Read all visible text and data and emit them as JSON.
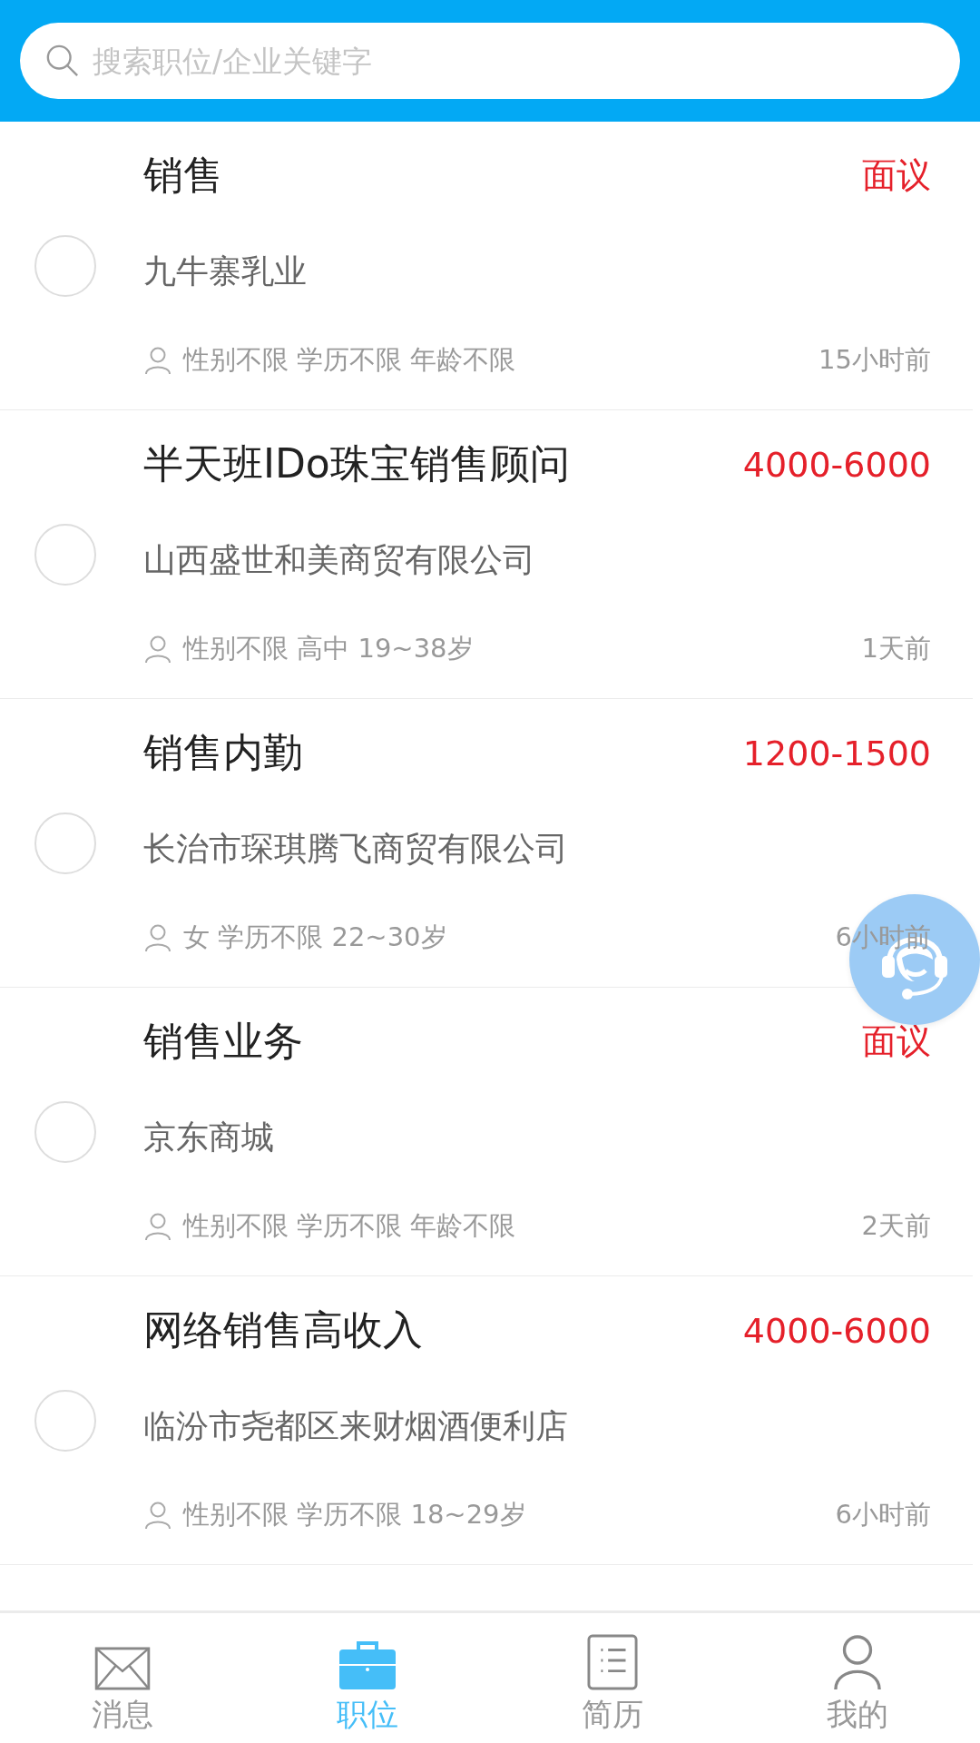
{
  "search": {
    "placeholder": "搜索职位/企业关键字"
  },
  "jobs": [
    {
      "title": "销售",
      "salary": "面议",
      "company": "九牛寨乳业",
      "requirements": "性别不限 学历不限 年龄不限",
      "posted": "15小时前",
      "selected": false
    },
    {
      "title": "半天班IDo珠宝销售顾问",
      "salary": "4000-6000",
      "company": "山西盛世和美商贸有限公司",
      "requirements": "性别不限 高中 19~38岁",
      "posted": "1天前",
      "selected": false
    },
    {
      "title": "销售内勤",
      "salary": "1200-1500",
      "company": "长治市琛琪腾飞商贸有限公司",
      "requirements": "女 学历不限 22~30岁",
      "posted": "6小时前",
      "selected": false
    },
    {
      "title": "销售业务",
      "salary": "面议",
      "company": "京东商城",
      "requirements": "性别不限 学历不限 年龄不限",
      "posted": "2天前",
      "selected": false
    },
    {
      "title": "网络销售高收入",
      "salary": "4000-6000",
      "company": "临汾市尧都区来财烟酒便利店",
      "requirements": "性别不限 学历不限 18~29岁",
      "posted": "6小时前",
      "selected": false
    }
  ],
  "tabs": [
    {
      "label": "消息",
      "kind": "mail",
      "selected": false
    },
    {
      "label": "职位",
      "kind": "briefcase",
      "selected": true
    },
    {
      "label": "简历",
      "kind": "resume",
      "selected": false
    },
    {
      "label": "我的",
      "kind": "person",
      "selected": false
    }
  ]
}
